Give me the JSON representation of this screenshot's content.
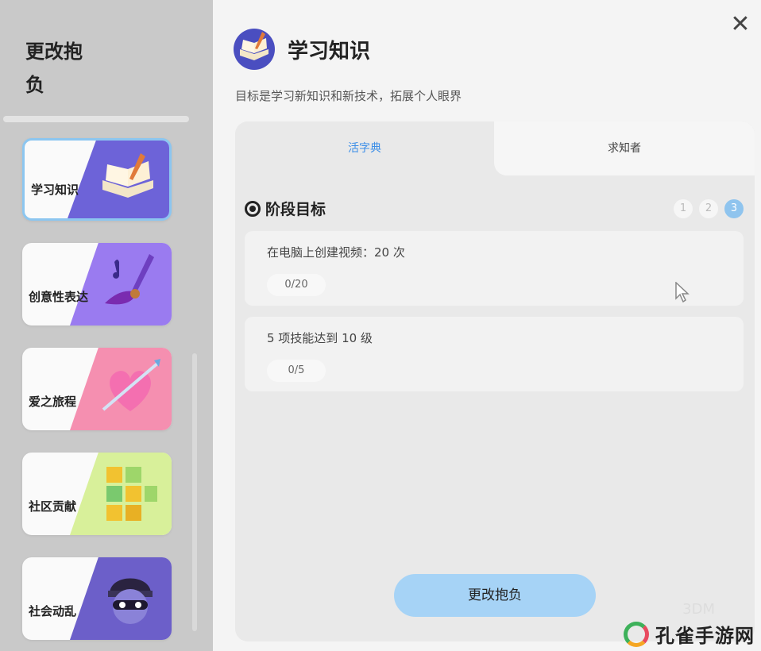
{
  "sidebar": {
    "title": "更改抱负",
    "cards": [
      {
        "label": "学习知识",
        "selected": true,
        "art_color": "#6d63d8",
        "icon": "book-quill-icon"
      },
      {
        "label": "创意性表达",
        "selected": false,
        "art_color": "#9a7bf0",
        "icon": "paint-brush-icon"
      },
      {
        "label": "爱之旅程",
        "selected": false,
        "art_color": "#f58fb0",
        "icon": "heart-arrow-icon"
      },
      {
        "label": "社区贡献",
        "selected": false,
        "art_color": "#d8f09a",
        "icon": "blocks-icon"
      },
      {
        "label": "社会动乱",
        "selected": false,
        "art_color": "#6c5fc9",
        "icon": "masked-bandit-icon"
      }
    ]
  },
  "header": {
    "title": "学习知识",
    "subtitle": "目标是学习新知识和新技术，拓展个人眼界",
    "icon": "book-quill-icon",
    "close_icon": "close-icon"
  },
  "tabs": [
    {
      "label": "活字典",
      "active": true
    },
    {
      "label": "求知者",
      "active": false
    }
  ],
  "stage": {
    "title": "阶段目标",
    "steps": [
      "1",
      "2",
      "3"
    ],
    "active_step": "3"
  },
  "goals": [
    {
      "text": "在电脑上创建视频：20 次",
      "progress": "0/20"
    },
    {
      "text": "5 项技能达到 10 级",
      "progress": "0/5"
    }
  ],
  "action": {
    "label": "更改抱负"
  },
  "watermark": {
    "text": "孔雀手游网",
    "faint_text": "3DM"
  },
  "colors": {
    "accent": "#3c8ee8",
    "button": "#a6d3f6",
    "selected_border": "#8cc6f0"
  }
}
